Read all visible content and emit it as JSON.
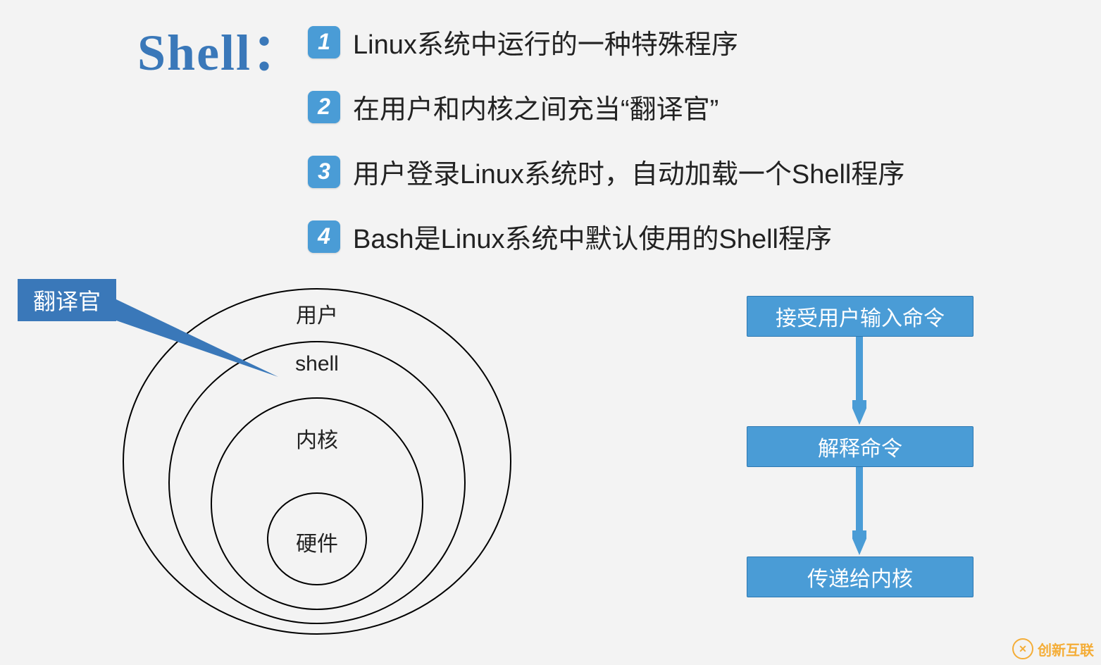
{
  "title": "Shell：",
  "bullets": [
    {
      "num": "1",
      "text": "Linux系统中运行的一种特殊程序"
    },
    {
      "num": "2",
      "text": "在用户和内核之间充当“翻译官”"
    },
    {
      "num": "3",
      "text": "用户登录Linux系统时，自动加载一个Shell程序"
    },
    {
      "num": "4",
      "text": "Bash是Linux系统中默认使用的Shell程序"
    }
  ],
  "callout": "翻译官",
  "layers": {
    "outer": "用户",
    "second": "shell",
    "third": "内核",
    "inner": "硬件"
  },
  "flow": {
    "step1": "接受用户输入命令",
    "step2": "解释命令",
    "step3": "传递给内核"
  },
  "watermark": "创新互联"
}
